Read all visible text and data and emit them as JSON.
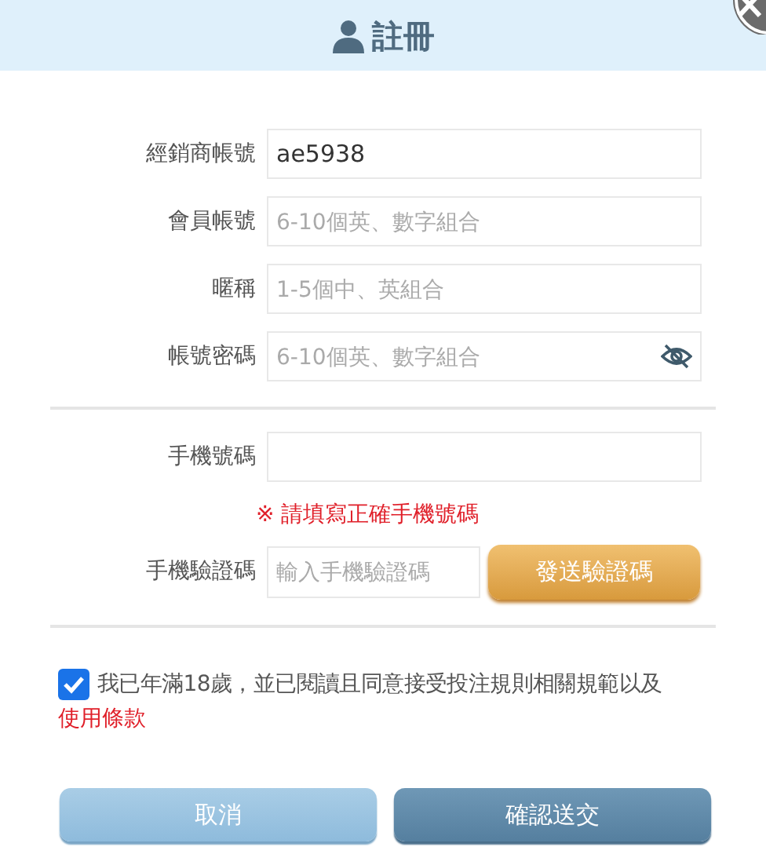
{
  "dialog": {
    "title": "註冊"
  },
  "fields": [
    {
      "kind": "text",
      "label": "經銷商帳號",
      "value": "ae5938"
    },
    {
      "kind": "text",
      "label": "會員帳號",
      "placeholder": "6-10個英、數字組合"
    },
    {
      "kind": "text",
      "label": "暱稱",
      "placeholder": "1-5個中、英組合"
    },
    {
      "kind": "password",
      "label": "帳號密碼",
      "placeholder": "6-10個英、數字組合"
    }
  ],
  "phone": {
    "label": "手機號碼",
    "error": "※ 請填寫正確手機號碼"
  },
  "verification": {
    "label": "手機驗證碼",
    "placeholder": "輸入手機驗證碼",
    "button": "發送驗證碼"
  },
  "agreement": {
    "checked": true,
    "text": "我已年滿18歲，並已閱讀且同意接受投注規則相關規範以及",
    "link": "使用條款"
  },
  "buttons": [
    {
      "kind": "cancel",
      "label": "取消"
    },
    {
      "kind": "submit",
      "label": "確認送交"
    }
  ]
}
